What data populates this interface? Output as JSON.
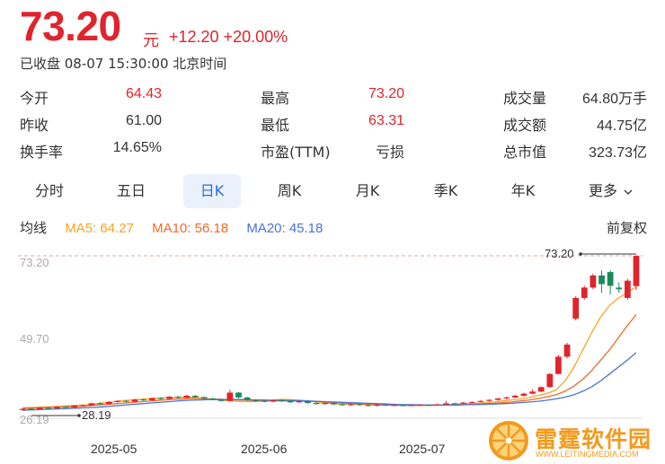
{
  "quote": {
    "price": "73.20",
    "unit": "元",
    "change": "+12.20 +20.00%",
    "status": "已收盘 08-07 15:30:00 北京时间"
  },
  "stats": [
    [
      {
        "label": "今开",
        "value": "64.43",
        "color": "red"
      },
      {
        "label": "最高",
        "value": "73.20",
        "color": "red"
      },
      {
        "label": "成交量",
        "value": "64.80万手",
        "color": "dark"
      }
    ],
    [
      {
        "label": "昨收",
        "value": "61.00",
        "color": "dark"
      },
      {
        "label": "最低",
        "value": "63.31",
        "color": "red"
      },
      {
        "label": "成交额",
        "value": "44.75亿",
        "color": "dark"
      }
    ],
    [
      {
        "label": "换手率",
        "value": "14.65%",
        "color": "dark"
      },
      {
        "label": "市盈(TTM)",
        "value": "亏损",
        "color": "dark"
      },
      {
        "label": "总市值",
        "value": "323.73亿",
        "color": "dark"
      }
    ]
  ],
  "tabs": [
    "分时",
    "五日",
    "日K",
    "周K",
    "月K",
    "季K",
    "年K",
    "更多"
  ],
  "active_tab": "日K",
  "ma": {
    "label": "均线",
    "ma5": "MA5: 64.27",
    "ma10": "MA10: 56.18",
    "ma20": "MA20: 45.18",
    "adjust": "前复权"
  },
  "colors": {
    "up": "#e0242d",
    "down": "#1b8a5a",
    "ma5": "#f5a623",
    "ma10": "#f06a2a",
    "ma20": "#4a72d8",
    "accent": "#2b6ce0"
  },
  "watermark": {
    "name": "雷霆软件园",
    "url": "WWW.LEITINGMEDIA.COM"
  },
  "chart_data": {
    "type": "candlestick",
    "y_ticks": [
      "73.20",
      "49.70",
      "26.19"
    ],
    "ylim": [
      26.19,
      73.2
    ],
    "x_ticks": [
      "2025-05",
      "2025-06",
      "2025-07"
    ],
    "annotations": {
      "high_label": "73.20",
      "low_label": "28.19"
    },
    "series": [
      {
        "name": "MA5",
        "values": [
          29.2,
          29.3,
          29.4,
          29.5,
          29.6,
          29.8,
          29.9,
          30.0,
          30.3,
          30.6,
          30.9,
          31.2,
          31.4,
          31.6,
          31.8,
          32.0,
          32.1,
          32.2,
          32.3,
          32.2,
          32.0,
          31.8,
          31.5,
          31.3,
          31.1,
          31.0,
          31.0,
          31.2,
          31.4,
          31.6,
          31.6,
          31.4,
          31.2,
          30.9,
          30.6,
          30.4,
          30.3,
          30.2,
          30.2,
          30.1,
          30.0,
          30.0,
          29.9,
          29.9,
          29.9,
          30.0,
          30.0,
          30.0,
          30.1,
          30.3,
          30.4,
          30.5,
          30.7,
          30.9,
          31.2,
          31.5,
          31.8,
          32.2,
          32.8,
          33.4,
          34.4,
          37.0,
          41.0,
          46.0,
          51.0,
          55.5,
          58.8,
          61.0,
          62.6,
          64.27
        ]
      },
      {
        "name": "MA10",
        "values": [
          29.0,
          29.1,
          29.2,
          29.3,
          29.4,
          29.5,
          29.6,
          29.7,
          29.9,
          30.1,
          30.3,
          30.5,
          30.7,
          30.9,
          31.1,
          31.3,
          31.5,
          31.7,
          31.8,
          31.9,
          31.9,
          31.8,
          31.7,
          31.6,
          31.5,
          31.4,
          31.3,
          31.2,
          31.2,
          31.2,
          31.2,
          31.2,
          31.1,
          31.0,
          30.9,
          30.7,
          30.6,
          30.4,
          30.3,
          30.2,
          30.1,
          30.0,
          30.0,
          29.9,
          29.9,
          29.9,
          29.9,
          30.0,
          30.0,
          30.1,
          30.2,
          30.3,
          30.4,
          30.5,
          30.7,
          30.9,
          31.2,
          31.5,
          31.9,
          32.4,
          33.0,
          34.0,
          35.5,
          37.5,
          40.0,
          43.0,
          46.0,
          49.5,
          53.0,
          56.18
        ]
      },
      {
        "name": "MA20",
        "values": [
          28.5,
          28.6,
          28.7,
          28.8,
          28.9,
          29.0,
          29.1,
          29.2,
          29.3,
          29.5,
          29.7,
          29.9,
          30.1,
          30.3,
          30.5,
          30.7,
          30.9,
          31.1,
          31.3,
          31.4,
          31.5,
          31.6,
          31.6,
          31.6,
          31.6,
          31.6,
          31.5,
          31.5,
          31.4,
          31.4,
          31.3,
          31.3,
          31.2,
          31.1,
          31.0,
          30.9,
          30.8,
          30.7,
          30.6,
          30.5,
          30.4,
          30.3,
          30.2,
          30.1,
          30.1,
          30.0,
          30.0,
          30.0,
          30.0,
          30.0,
          30.1,
          30.1,
          30.2,
          30.3,
          30.4,
          30.5,
          30.7,
          30.9,
          31.1,
          31.4,
          31.8,
          32.3,
          33.0,
          34.0,
          35.3,
          37.0,
          39.0,
          41.0,
          43.0,
          45.18
        ]
      }
    ],
    "candles": [
      [
        28.6,
        28.9,
        28.4,
        29.0
      ],
      [
        28.9,
        28.8,
        28.6,
        29.1
      ],
      [
        28.8,
        29.2,
        28.7,
        29.4
      ],
      [
        29.2,
        29.0,
        28.9,
        29.4
      ],
      [
        29.0,
        29.5,
        28.9,
        29.7
      ],
      [
        29.5,
        29.3,
        29.2,
        29.7
      ],
      [
        29.3,
        29.8,
        29.2,
        30.0
      ],
      [
        29.8,
        29.9,
        29.6,
        30.2
      ],
      [
        29.9,
        30.5,
        29.8,
        30.7
      ],
      [
        30.5,
        30.3,
        30.1,
        30.8
      ],
      [
        30.3,
        30.9,
        30.2,
        31.1
      ],
      [
        30.9,
        31.2,
        30.7,
        31.4
      ],
      [
        31.2,
        31.0,
        30.8,
        31.5
      ],
      [
        31.0,
        31.6,
        30.9,
        31.8
      ],
      [
        31.6,
        31.4,
        31.2,
        31.9
      ],
      [
        31.4,
        32.0,
        31.3,
        32.2
      ],
      [
        32.0,
        31.8,
        31.6,
        32.3
      ],
      [
        31.8,
        32.4,
        31.7,
        32.6
      ],
      [
        32.4,
        32.1,
        31.9,
        32.7
      ],
      [
        32.1,
        32.7,
        32.0,
        33.0
      ],
      [
        32.7,
        32.3,
        32.1,
        32.9
      ],
      [
        32.3,
        31.9,
        31.7,
        32.5
      ],
      [
        31.9,
        31.6,
        31.4,
        32.1
      ],
      [
        31.6,
        31.2,
        31.0,
        31.8
      ],
      [
        31.2,
        33.6,
        31.1,
        34.4
      ],
      [
        33.6,
        32.2,
        31.9,
        33.8
      ],
      [
        32.2,
        31.5,
        31.2,
        32.4
      ],
      [
        31.5,
        31.2,
        30.9,
        31.7
      ],
      [
        31.2,
        31.0,
        30.8,
        31.4
      ],
      [
        31.0,
        31.4,
        30.8,
        31.6
      ],
      [
        31.4,
        31.2,
        30.9,
        31.6
      ],
      [
        31.2,
        30.8,
        30.6,
        31.3
      ],
      [
        30.8,
        31.1,
        30.6,
        31.3
      ],
      [
        31.1,
        30.6,
        30.4,
        31.2
      ],
      [
        30.6,
        30.3,
        30.1,
        30.8
      ],
      [
        30.3,
        30.6,
        30.1,
        30.8
      ],
      [
        30.6,
        30.2,
        30.0,
        30.7
      ],
      [
        30.2,
        30.0,
        29.8,
        30.4
      ],
      [
        30.0,
        30.3,
        29.8,
        30.5
      ],
      [
        30.3,
        30.0,
        29.8,
        30.4
      ],
      [
        30.0,
        29.8,
        29.6,
        30.2
      ],
      [
        29.8,
        30.1,
        29.6,
        30.3
      ],
      [
        30.1,
        29.9,
        29.7,
        30.2
      ],
      [
        29.9,
        30.0,
        29.8,
        30.2
      ],
      [
        30.0,
        29.8,
        29.6,
        30.1
      ],
      [
        29.8,
        30.0,
        29.7,
        30.2
      ],
      [
        30.0,
        30.1,
        29.9,
        30.3
      ],
      [
        30.1,
        30.0,
        29.8,
        30.2
      ],
      [
        30.0,
        30.2,
        29.9,
        30.4
      ],
      [
        30.2,
        30.5,
        30.1,
        31.2
      ],
      [
        30.5,
        30.4,
        30.2,
        30.7
      ],
      [
        30.4,
        30.7,
        30.3,
        30.9
      ],
      [
        30.7,
        30.9,
        30.5,
        31.1
      ],
      [
        30.9,
        31.2,
        30.8,
        31.4
      ],
      [
        31.2,
        31.5,
        31.0,
        31.7
      ],
      [
        31.5,
        31.9,
        31.3,
        32.1
      ],
      [
        31.9,
        32.2,
        31.7,
        32.5
      ],
      [
        32.2,
        32.7,
        32.0,
        33.0
      ],
      [
        32.7,
        33.3,
        32.5,
        33.6
      ],
      [
        33.3,
        33.9,
        33.1,
        34.6
      ],
      [
        33.9,
        35.2,
        33.7,
        35.4
      ],
      [
        35.2,
        39.0,
        35.0,
        39.2
      ],
      [
        39.0,
        44.0,
        38.8,
        44.5
      ],
      [
        44.0,
        47.5,
        43.5,
        48.0
      ],
      [
        55.0,
        61.0,
        54.5,
        61.5
      ],
      [
        61.0,
        64.0,
        60.5,
        64.5
      ],
      [
        64.0,
        67.5,
        63.5,
        68.0
      ],
      [
        67.5,
        65.0,
        62.5,
        69.0
      ],
      [
        68.5,
        64.5,
        62.0,
        69.0
      ],
      [
        64.0,
        63.5,
        62.5,
        65.5
      ],
      [
        61.0,
        66.0,
        60.5,
        66.5
      ],
      [
        64.43,
        73.2,
        63.31,
        73.2
      ]
    ]
  }
}
